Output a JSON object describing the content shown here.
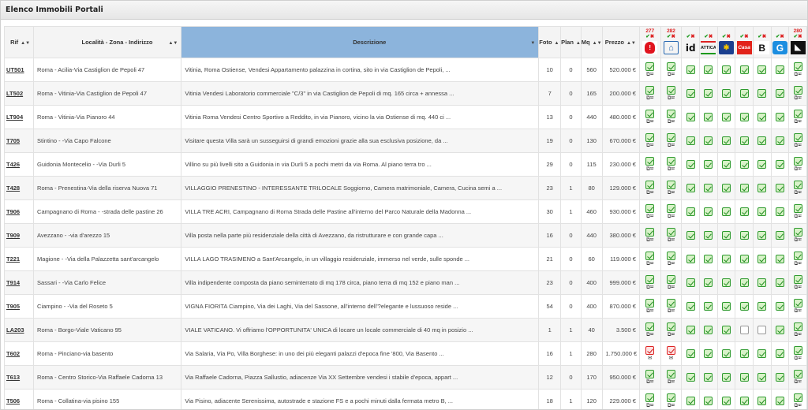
{
  "panel": {
    "title": "Elenco Immobili Portali"
  },
  "columns": {
    "rif": "Rif",
    "localita": "Località - Zona - Indirizzo",
    "descrizione": "Descrizione",
    "foto": "Foto",
    "plan": "Plan",
    "mq": "Mq",
    "prezzo": "Prezzo"
  },
  "portals": [
    {
      "count": "277",
      "ok": true,
      "ko": true,
      "icon": "immobiliare-logo-icon",
      "label": "!",
      "cls": "l1"
    },
    {
      "count": "282",
      "ok": true,
      "ko": true,
      "icon": "casa-logo-icon",
      "label": "⌂",
      "cls": "l2"
    },
    {
      "count": "",
      "ok": true,
      "ko": true,
      "icon": "idealista-logo-icon",
      "label": "id",
      "cls": "l3"
    },
    {
      "count": "",
      "ok": true,
      "ko": true,
      "icon": "attica-logo-icon",
      "label": "ATTICA",
      "cls": "l4"
    },
    {
      "count": "",
      "ok": true,
      "ko": true,
      "icon": "roma-logo-icon",
      "label": "✱",
      "cls": "l5"
    },
    {
      "count": "",
      "ok": true,
      "ko": true,
      "icon": "casaimmobiliare-logo-icon",
      "label": "Casa",
      "cls": "l6"
    },
    {
      "count": "",
      "ok": true,
      "ko": true,
      "icon": "b-logo-icon",
      "label": "B",
      "cls": "l7"
    },
    {
      "count": "",
      "ok": true,
      "ko": true,
      "icon": "g-logo-icon",
      "label": "G",
      "cls": "l8"
    },
    {
      "count": "280",
      "ok": true,
      "ko": true,
      "icon": "corner-logo-icon",
      "label": "◣",
      "cls": "l9"
    }
  ],
  "rows": [
    {
      "rif": "UT501",
      "loc": "Roma - Acilia-Via Castiglion de Pepoli 47",
      "desc": "Vitinia, Roma Ostiense, Vendesi Appartamento palazzina in cortina, sito in via Castiglion de Pepoli, ...",
      "foto": "10",
      "plan": "0",
      "mq": "560",
      "prezzo": "520.000 €",
      "st": [
        "ok",
        "ok",
        "ok",
        "ok",
        "ok",
        "ok",
        "ok",
        "ok",
        "ok"
      ]
    },
    {
      "rif": "LT502",
      "loc": "Roma - Vitinia-Via Castiglion de Pepoli 47",
      "desc": "Vitinia Vendesi Laboratorio commerciale \"C/3\" in via Castiglion de Pepoli di mq. 165 circa + annessa ...",
      "foto": "7",
      "plan": "0",
      "mq": "165",
      "prezzo": "200.000 €",
      "st": [
        "ok",
        "ok",
        "ok",
        "ok",
        "ok",
        "ok",
        "ok",
        "ok",
        "ok"
      ]
    },
    {
      "rif": "LT904",
      "loc": "Roma - Vitinia-Via Pianoro 44",
      "desc": "Vitinia Roma Vendesi Centro Sportivo a Reddito, in via Pianoro, vicino la via Ostiense di mq. 440 ci ...",
      "foto": "13",
      "plan": "0",
      "mq": "440",
      "prezzo": "480.000 €",
      "st": [
        "ok",
        "ok",
        "ok",
        "ok",
        "ok",
        "ok",
        "ok",
        "ok",
        "ok"
      ]
    },
    {
      "rif": "T705",
      "loc": "Stintino - -Via Capo Falcone",
      "desc": "Visitare questa Villa sarà un susseguirsi di grandi emozioni grazie alla sua esclusiva posizione, da ...",
      "foto": "19",
      "plan": "0",
      "mq": "130",
      "prezzo": "670.000 €",
      "st": [
        "ok",
        "ok",
        "ok",
        "ok",
        "ok",
        "ok",
        "ok",
        "ok",
        "ok"
      ]
    },
    {
      "rif": "T426",
      "loc": "Guidonia Montecelio - -Via Durli 5",
      "desc": "Villino su più livelli sito a Guidonia in via Durli 5 a pochi metri da via Roma. Al piano terra tro ...",
      "foto": "29",
      "plan": "0",
      "mq": "115",
      "prezzo": "230.000 €",
      "st": [
        "ok",
        "ok",
        "ok",
        "ok",
        "ok",
        "ok",
        "ok",
        "ok",
        "ok"
      ]
    },
    {
      "rif": "T428",
      "loc": "Roma - Prenestina-Via della riserva Nuova 71",
      "desc": "VILLAGGIO PRENESTINO - INTERESSANTE TRILOCALE Soggiorno, Camera matrimoniale, Camera, Cucina semi a ...",
      "foto": "23",
      "plan": "1",
      "mq": "80",
      "prezzo": "129.000 €",
      "st": [
        "ok",
        "ok",
        "ok",
        "ok",
        "ok",
        "ok",
        "ok",
        "ok",
        "ok"
      ]
    },
    {
      "rif": "T906",
      "loc": "Campagnano di Roma - -strada delle pastine 26",
      "desc": "VILLA TRE ACRI, Campagnano di Roma Strada delle Pastine all'interno del Parco Naturale della Madonna ...",
      "foto": "30",
      "plan": "1",
      "mq": "460",
      "prezzo": "930.000 €",
      "st": [
        "ok",
        "ok",
        "ok",
        "ok",
        "ok",
        "ok",
        "ok",
        "ok",
        "ok"
      ]
    },
    {
      "rif": "T909",
      "loc": "Avezzano - -via d'arezzo 15",
      "desc": "Villa posta nella parte più residenziale della città di Avezzano, da ristrutturare e con grande capa ...",
      "foto": "16",
      "plan": "0",
      "mq": "440",
      "prezzo": "380.000 €",
      "st": [
        "ok",
        "ok",
        "ok",
        "ok",
        "ok",
        "ok",
        "ok",
        "ok",
        "ok"
      ]
    },
    {
      "rif": "T221",
      "loc": "Magione - -Via della Palazzetta sant'arcangelo",
      "desc": "VILLA LAGO TRASIMENO a Sant'Arcangelo, in un villaggio residenziale, immerso nel verde, sulle sponde ...",
      "foto": "21",
      "plan": "0",
      "mq": "60",
      "prezzo": "119.000 €",
      "st": [
        "ok",
        "ok",
        "ok",
        "ok",
        "ok",
        "ok",
        "ok",
        "ok",
        "ok"
      ]
    },
    {
      "rif": "T914",
      "loc": "Sassari - -Via Carlo Felice",
      "desc": "Villa indipendente composta da piano seminterrato di mq 178 circa, piano terra di mq 152 e piano man ...",
      "foto": "23",
      "plan": "0",
      "mq": "400",
      "prezzo": "999.000 €",
      "st": [
        "ok",
        "ok",
        "ok",
        "ok",
        "ok",
        "ok",
        "ok",
        "ok",
        "ok"
      ]
    },
    {
      "rif": "T905",
      "loc": "Ciampino - -Via del Roseto 5",
      "desc": "VIGNA FIORITA Ciampino, Via dei Laghi, Via del Sassone, all'interno dell'?elegante e lussuoso reside ...",
      "foto": "54",
      "plan": "0",
      "mq": "400",
      "prezzo": "870.000 €",
      "st": [
        "ok",
        "ok",
        "ok",
        "ok",
        "ok",
        "ok",
        "ok",
        "ok",
        "ok"
      ]
    },
    {
      "rif": "LA203",
      "loc": "Roma - Borgo-Viale Vaticano 95",
      "desc": "VIALE VATICANO. Vi offriamo l'OPPORTUNITA' UNICA di locare un locale commerciale di 40 mq in posizio ...",
      "foto": "1",
      "plan": "1",
      "mq": "40",
      "prezzo": "3.500 €",
      "st": [
        "ok",
        "ok",
        "ok",
        "ok",
        "ok",
        "off",
        "off",
        "ok",
        "ok"
      ]
    },
    {
      "rif": "T602",
      "loc": "Roma - Pinciano-via basento",
      "desc": "Via Salaria, Via Po, Villa Borghese: in uno dei più eleganti palazzi d'epoca fine '800, Via Basento ...",
      "foto": "16",
      "plan": "1",
      "mq": "280",
      "prezzo": "1.750.000 €",
      "st": [
        "err",
        "err",
        "ok",
        "ok",
        "ok",
        "ok",
        "ok",
        "ok",
        "ok"
      ]
    },
    {
      "rif": "T613",
      "loc": "Roma - Centro Storico-Via Raffaele Cadorna 13",
      "desc": "Via Raffaele Cadorna, Piazza Sallustio, adiacenze Via XX Settembre vendesi i stabile d'epoca, appart ...",
      "foto": "12",
      "plan": "0",
      "mq": "170",
      "prezzo": "950.000 €",
      "st": [
        "ok",
        "ok",
        "ok",
        "ok",
        "ok",
        "ok",
        "ok",
        "ok",
        "ok"
      ]
    },
    {
      "rif": "T506",
      "loc": "Roma - Collatina-via pisino 155",
      "desc": "Via Pisino, adiacente Serenissima, autostrade e stazione FS e a pochi minuti dalla fermata metro B, ...",
      "foto": "18",
      "plan": "1",
      "mq": "120",
      "prezzo": "229.000 €",
      "st": [
        "ok",
        "ok",
        "ok",
        "ok",
        "ok",
        "ok",
        "ok",
        "ok",
        "ok"
      ]
    }
  ]
}
